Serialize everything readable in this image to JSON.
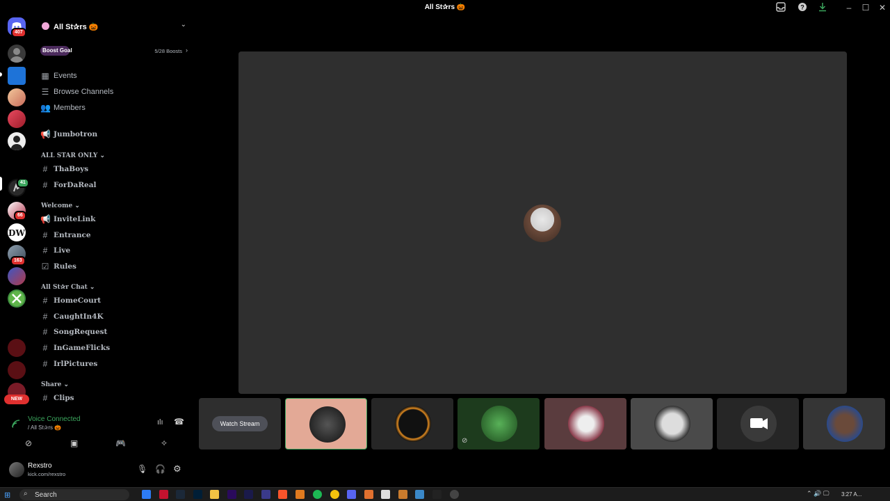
{
  "window": {
    "title": "All St✰rs 🎃"
  },
  "rail": {
    "dm_badge": "407",
    "badges": [
      "41",
      "66",
      "163"
    ],
    "new_label": "NEW"
  },
  "server": {
    "name": "All St✰rs 🎃",
    "boost_goal_label": "Boost Goal",
    "boost_progress": "5/28 Boosts",
    "boost_fraction": 0.18
  },
  "nav": {
    "events": "Events",
    "browse": "Browse Channels",
    "members": "Members"
  },
  "channels": {
    "jumbotron": "Jumbotron",
    "cat_allstar_only": "ALL STAR ONLY",
    "thaboys": "ThaBoys",
    "fordareal": "ForDaReal",
    "cat_welcome": "Welcome",
    "invitelink": "InviteLink",
    "entrance": "Entrance",
    "live": "Live",
    "rules": "Rules",
    "cat_chat": "All St✰r Chat",
    "homecourt": "HomeCourt",
    "caughtin4k": "CaughtIn4K",
    "songrequest": "SongRequest",
    "ingameflicks": "InGameFlicks",
    "irlpictures": "IrlPictures",
    "cat_share": "Share",
    "clips": "Clips"
  },
  "voice": {
    "status": "Voice Connected",
    "channel": "/ All St✰rs 🎃"
  },
  "user": {
    "name": "Rexstro",
    "status": "kick.com/rexstro"
  },
  "tiles": {
    "watch_stream": "Watch Stream"
  },
  "taskbar": {
    "search_placeholder": "Search",
    "clock": "3:27 A..."
  }
}
